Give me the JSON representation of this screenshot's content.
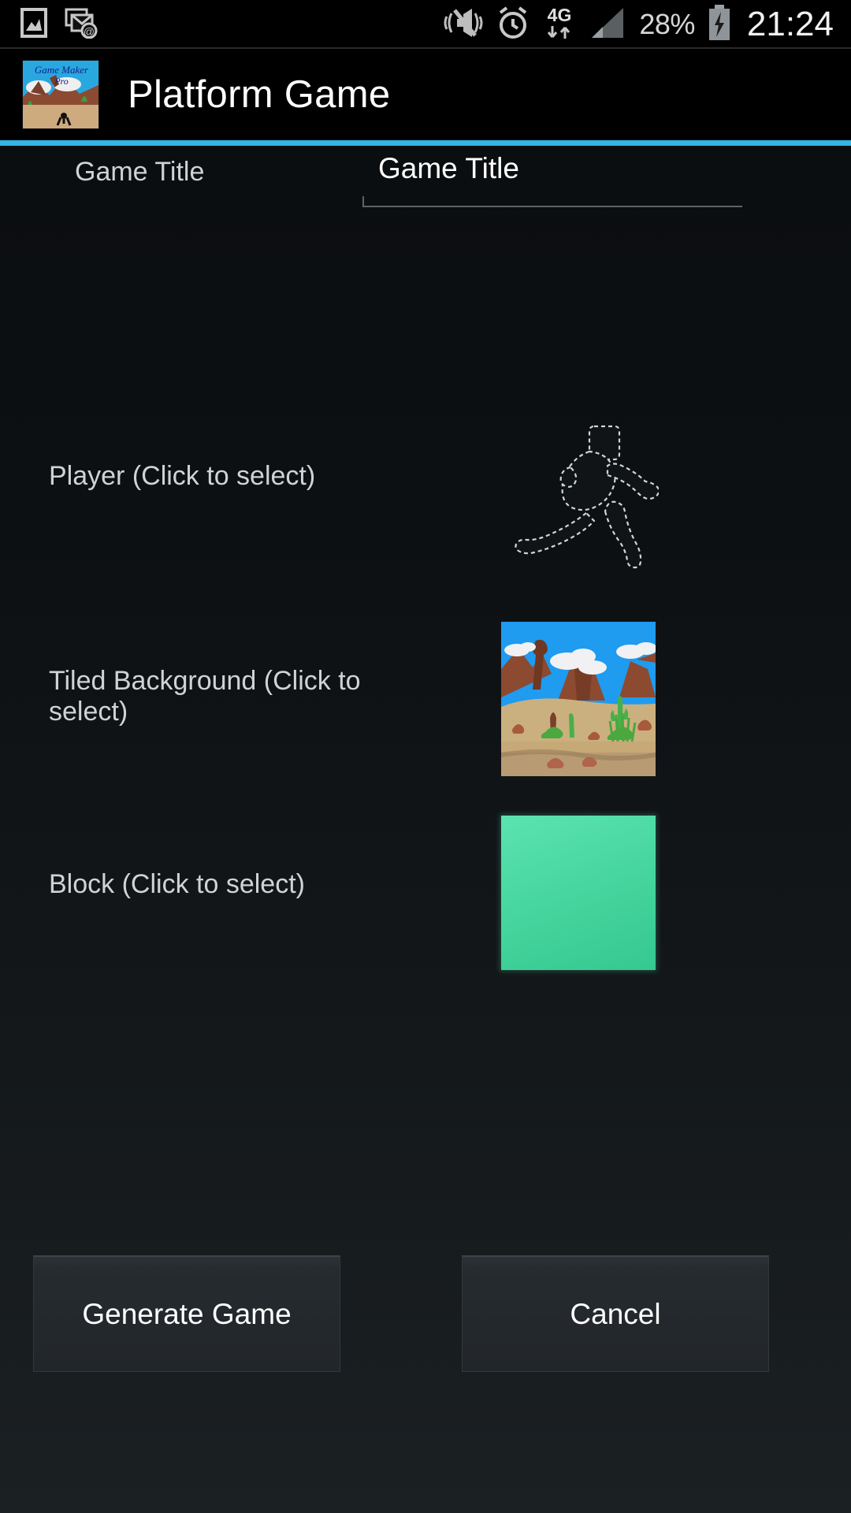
{
  "statusbar": {
    "icons_left": [
      "gallery-icon",
      "email-at-icon"
    ],
    "icons_right": [
      "vibrate-off-icon",
      "alarm-icon",
      "network-4g-icon",
      "signal-bars-icon"
    ],
    "network_label": "4G",
    "battery_percent": "28%",
    "clock": "21:24"
  },
  "appbar": {
    "icon_name": "game-maker-pro-icon",
    "icon_text_line1": "Game Maker",
    "icon_text_line2": "Pro",
    "title": "Platform Game",
    "accent_color": "#33b5e5"
  },
  "form": {
    "title_row": {
      "label": "Game Title",
      "input_value": "Game Title",
      "input_placeholder": "Game Title"
    },
    "selectors": [
      {
        "label": "Player (Click to select)",
        "thumb_name": "player-sprite-thumbnail",
        "thumb_kind": "runner-silhouette"
      },
      {
        "label": "Tiled Background (Click to select)",
        "thumb_name": "tiled-background-thumbnail",
        "thumb_kind": "desert-scene"
      },
      {
        "label": "Block (Click to select)",
        "thumb_name": "block-thumbnail",
        "thumb_kind": "green-square",
        "color": "#4ddca8"
      }
    ]
  },
  "buttons": {
    "generate": "Generate Game",
    "cancel": "Cancel"
  }
}
